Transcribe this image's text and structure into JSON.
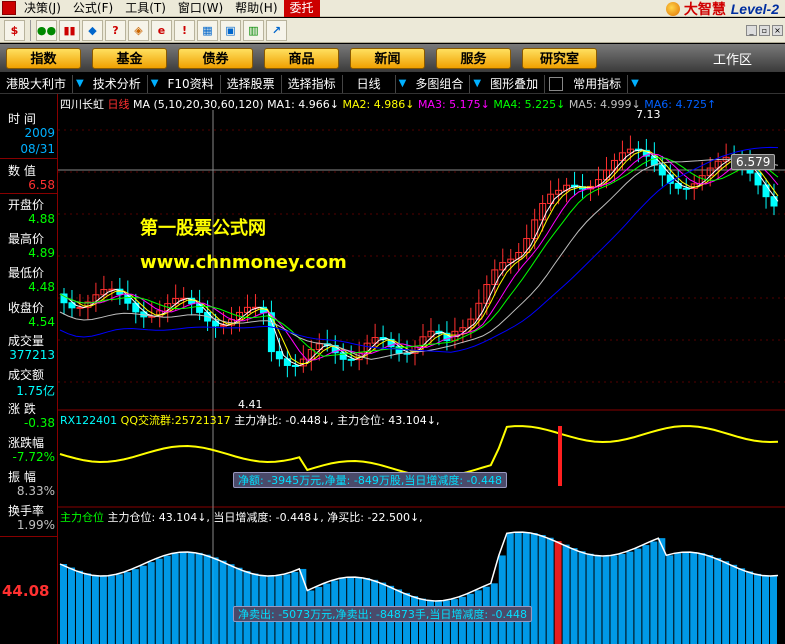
{
  "menu": {
    "items": [
      "决策(J)",
      "公式(F)",
      "工具(T)",
      "窗口(W)",
      "帮助(H)",
      "委托"
    ],
    "brand": "大智慧",
    "brand_level": "Level-2"
  },
  "toolbar": {
    "icons": [
      "dollar-icon",
      "glasses-icon",
      "columns-icon",
      "shield-icon",
      "help-icon",
      "diamond-icon",
      "e-icon",
      "alert-icon",
      "grid-icon",
      "window-icon",
      "chart-icon",
      "arrow-icon"
    ]
  },
  "nav": {
    "buttons": [
      "指数",
      "基金",
      "债券",
      "商品",
      "新闻",
      "服务",
      "研究室"
    ],
    "workspace": "工作区"
  },
  "subbar": {
    "items": [
      "港股大利市",
      "技术分析",
      "F10资料",
      "选择股票",
      "选择指标",
      "日线",
      "多图组合",
      "图形叠加",
      "常用指标"
    ]
  },
  "side": {
    "time_label": "时 间",
    "time_year": "2009",
    "time_date": "08/31",
    "value_label": "数 值",
    "value": "6.58",
    "open_label": "开盘价",
    "open": "4.88",
    "high_label": "最高价",
    "high": "4.89",
    "low_label": "最低价",
    "low": "4.48",
    "close_label": "收盘价",
    "close": "4.54",
    "volume_label": "成交量",
    "volume": "377213",
    "amount_label": "成交额",
    "amount": "1.75亿",
    "change_label": "涨 跌",
    "change": "-0.38",
    "pct_label": "涨跌幅",
    "pct": "-7.72%",
    "amp_label": "振 幅",
    "amp": "8.33%",
    "turnover_label": "换手率",
    "turnover": "1.99%",
    "lower_value": "44.08"
  },
  "main": {
    "stock_name": "四川长虹",
    "period": "日线",
    "ma_params": "MA (5,10,20,30,60,120)",
    "ma1": "MA1: 4.966↓",
    "ma2": "MA2: 4.986↓",
    "ma3": "MA3: 5.175↓",
    "ma4": "MA4: 5.225↓",
    "ma5": "MA5: 4.999↓",
    "ma6": "MA6: 4.725↑",
    "high_mark": "7.13",
    "low_mark": "4.41",
    "price_tag": "6.579",
    "watermark1": "第一股票公式网",
    "watermark2": "www.chnmoney.com"
  },
  "mid_panel": {
    "name": "RX122401",
    "qq": "QQ交流群:25721317",
    "net": "主力净比: -0.448↓,",
    "pos": "主力仓位: 43.104↓,",
    "tip": "净额: -3945万元,净量: -849万股,当日增减度: -0.448"
  },
  "low_panel": {
    "name": "主力仓位",
    "pos": "主力仓位: 43.104↓,",
    "chg": "当日增减度: -0.448↓,",
    "buy": "净买比: -22.500↓,",
    "tip": "净卖出: -5073万元,净卖出: -84873手,当日增减度: -0.448"
  },
  "colors": {
    "ma1": "#ffffff",
    "ma2": "#ffff00",
    "ma3": "#ff00ff",
    "ma4": "#00ff00",
    "ma5": "#c0c0c0",
    "ma6": "#0000ff",
    "up": "#ff3030",
    "down": "#00ffff"
  }
}
